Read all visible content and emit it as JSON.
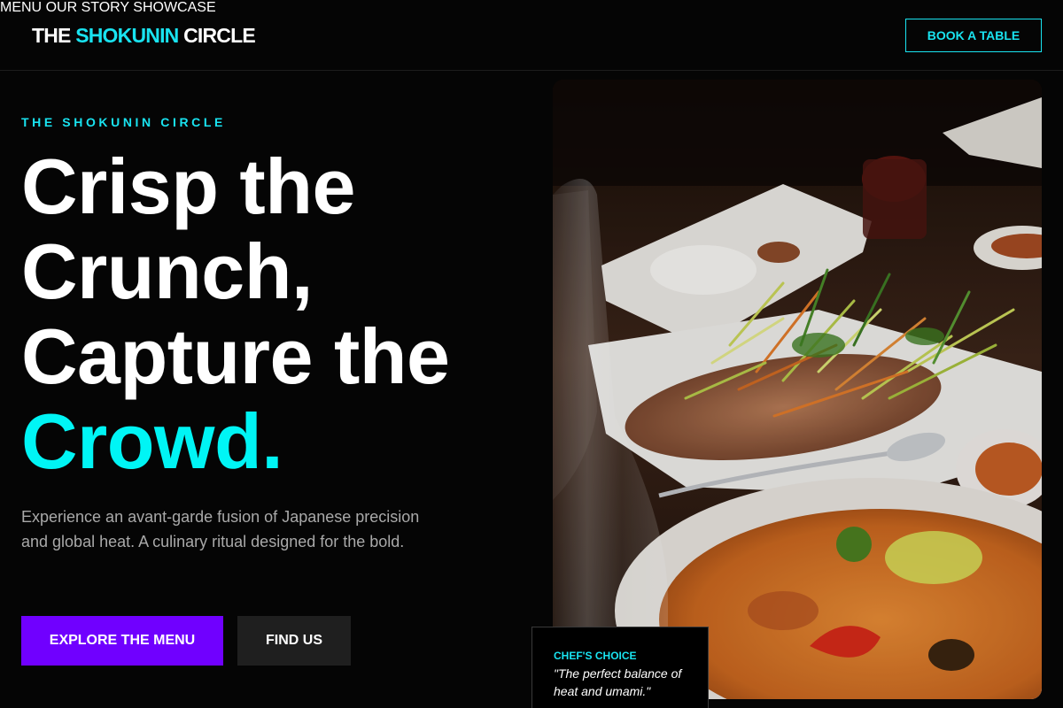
{
  "brand": {
    "logo_part1": "THE ",
    "logo_accent": "SHOKUNIN",
    "logo_part2": " CIRCLE",
    "accent_color": "#19e3f0",
    "primary_color": "#7000ff"
  },
  "nav": {
    "items": [
      {
        "label": "MENU"
      },
      {
        "label": "OUR STORY"
      },
      {
        "label": "SHOWCASE"
      }
    ],
    "cta_label": "BOOK A TABLE"
  },
  "hero": {
    "eyebrow": "THE SHOKUNIN CIRCLE",
    "headline_lines": [
      "Crisp the",
      "Crunch,",
      "Capture the"
    ],
    "headline_accent": "Crowd.",
    "subcopy": "Experience an avant-garde fusion of Japanese precision and global heat. A culinary ritual designed for the bold.",
    "primary_button": "EXPLORE THE MENU",
    "secondary_button": "FIND US"
  },
  "feature_card": {
    "label": "CHEF'S CHOICE",
    "quote": "\"The perfect balance of heat and umami.\""
  },
  "image": {
    "subject": "plated-crispy-fish-with-slaw-and-curry"
  }
}
